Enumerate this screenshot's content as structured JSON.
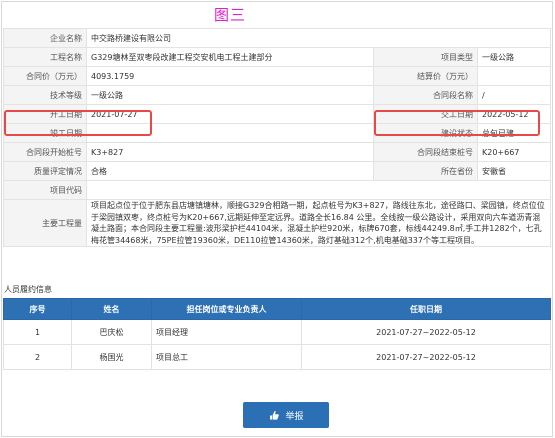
{
  "figure_title": "图三",
  "project": {
    "rows": [
      {
        "l1": "企业名称",
        "v1": "中交路桥建设有限公司",
        "l2": "",
        "v2": ""
      },
      {
        "l1": "工程名称",
        "v1": "G329塘林至双枣段改建工程交安机电工程土建部分",
        "l2": "项目类型",
        "v2": "一级公路"
      },
      {
        "l1": "合同价（万元）",
        "v1": "4093.1759",
        "l2": "结算价（万元）",
        "v2": ""
      },
      {
        "l1": "技术等级",
        "v1": "一级公路",
        "l2": "合同段名称",
        "v2": "/"
      },
      {
        "l1": "开工日期",
        "v1": "2021-07-27",
        "l2": "交工日期",
        "v2": "2022-05-12"
      },
      {
        "l1": "竣工日期",
        "v1": "",
        "l2": "建设状态",
        "v2": "总包已建"
      },
      {
        "l1": "合同段开始桩号",
        "v1": "K3+827",
        "l2": "合同段结束桩号",
        "v2": "K20+667"
      },
      {
        "l1": "质量评定情况",
        "v1": "合格",
        "l2": "所在省份",
        "v2": "安徽省"
      },
      {
        "l1": "项目代码",
        "v1": "",
        "l2": "",
        "v2": ""
      }
    ],
    "main_label": "主要工程量",
    "main_value": "项目起点位于位于肥东县店塘镇塘林，顺接G329合相路一期，起点桩号为K3+827，路线往东北，途径路口、梁园镇，终点位位于梁园镇双枣，终点桩号为K20+667,远期延伸至定远界。道路全长16.84 公里。全线按一级公路设计，采用双向六车道沥青混凝土路面；本合同段主要工程量:波形梁护栏44104米，混凝土护栏920米，标牌670套，标线44249.8㎡,手工井1282个，七孔梅花管34468米，75PE拉管19360米，DE110拉管14360米，路灯基础312个,机电基础337个等工程项目。"
  },
  "personnel": {
    "title": "人员履约信息",
    "headers": [
      "序号",
      "姓名",
      "担任岗位或专业负责人",
      "任职日期"
    ],
    "rows": [
      [
        "1",
        "巴庆松",
        "项目经理",
        "2021-07-27~2022-05-12"
      ],
      [
        "2",
        "杨国光",
        "项目总工",
        "2021-07-27~2022-05-12"
      ]
    ]
  },
  "report_button": {
    "label": "举报",
    "icon": "report-hand-icon"
  },
  "colors": {
    "header_bg": "#2d70b4",
    "highlight": "#e84848",
    "title": "#e020c8"
  }
}
